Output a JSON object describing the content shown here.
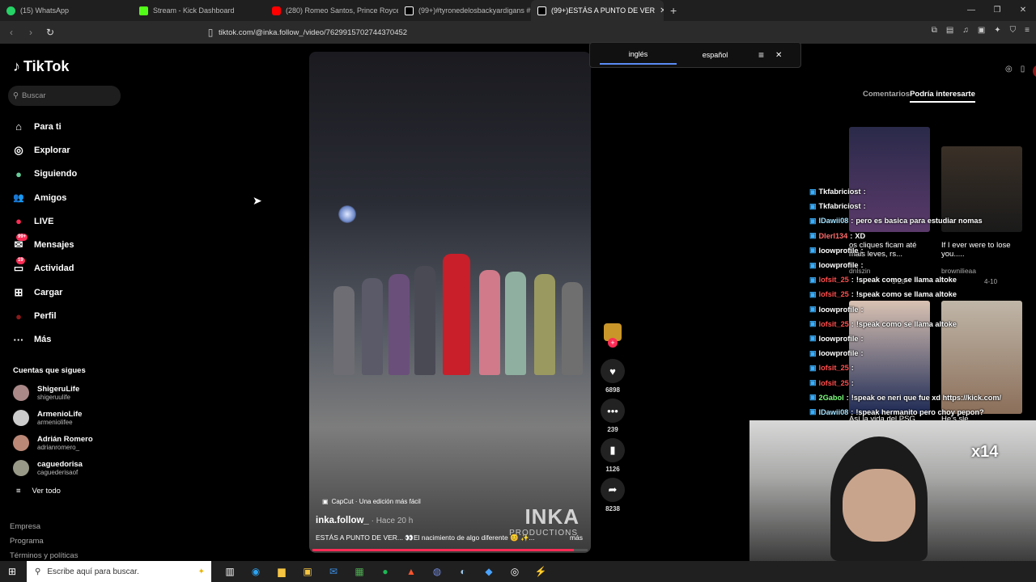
{
  "browser": {
    "tabs": [
      {
        "label": "(15) WhatsApp",
        "color": "#25d366"
      },
      {
        "label": "Stream - Kick Dashboard",
        "color": "#53fc18"
      },
      {
        "label": "(280) Romeo Santos, Prince Royce - E",
        "color": "#ff0000"
      },
      {
        "label": "(99+)#tyronedelosbackyardigans #p",
        "color": "#ffffff"
      },
      {
        "label": "(99+)ESTÁS A PUNTO DE VER",
        "color": "#ffffff"
      }
    ],
    "url": "tiktok.com/@inka.follow_/video/7629915702744370452"
  },
  "translate": {
    "opt1": "inglés",
    "opt2": "español"
  },
  "sidebar": {
    "logo": "TikTok",
    "search_placeholder": "Buscar",
    "menu": [
      {
        "label": "Para ti",
        "icon": "home-icon",
        "glyph": "⌂"
      },
      {
        "label": "Explorar",
        "icon": "compass-icon",
        "glyph": "◎"
      },
      {
        "label": "Siguiendo",
        "icon": "following-icon",
        "glyph": "●"
      },
      {
        "label": "Amigos",
        "icon": "friends-icon",
        "glyph": "👥"
      },
      {
        "label": "LIVE",
        "icon": "live-icon",
        "glyph": "●"
      },
      {
        "label": "Mensajes",
        "icon": "messages-icon",
        "glyph": "✉",
        "badge": "99+"
      },
      {
        "label": "Actividad",
        "icon": "activity-icon",
        "glyph": "▭",
        "badge": "19"
      },
      {
        "label": "Cargar",
        "icon": "upload-icon",
        "glyph": "⊞"
      },
      {
        "label": "Perfil",
        "icon": "profile-icon",
        "glyph": "●"
      },
      {
        "label": "Más",
        "icon": "more-icon",
        "glyph": "···"
      }
    ],
    "following_title": "Cuentas que sigues",
    "accounts": [
      {
        "name": "ShigeruLife",
        "handle": "shigeruulife"
      },
      {
        "name": "ArmenioLife",
        "handle": "armeniolifee"
      },
      {
        "name": "Adrián Romero",
        "handle": "adrianromero_"
      },
      {
        "name": "caguedorisa",
        "handle": "caguederisaof"
      }
    ],
    "see_all": "Ver todo",
    "footer": [
      "Empresa",
      "Programa",
      "Términos y políticas"
    ]
  },
  "video": {
    "capcut": "CapCut · Una edición más fácil",
    "watermark": "INKA",
    "watermark_sub": "PRODUCTIONS",
    "author": "inka.follow_",
    "time": " · Hace 20 h",
    "description": "ESTÁS A PUNTO DE VER... 👀El nacimiento de algo diferente 😊 ✨...",
    "more": "más",
    "progress": 0.95
  },
  "actions": {
    "likes": "6898",
    "comments": "239",
    "saves": "1126",
    "shares": "8238"
  },
  "right_panel": {
    "tab_comments": "Comentarios",
    "tab_interest": "Podría interesarte",
    "card1_title": "os cliques ficam até mais leves, rs...",
    "card1_user": "dnlszin",
    "card1_meta": "3-28",
    "card2_title": "If I ever were to lose you.....",
    "card2_user": "brownilieaa",
    "card2_meta": "4-10",
    "card3_caption": "Así la vida del PSG",
    "card4_caption": "He's sle"
  },
  "chat": [
    {
      "user": "Tkfabriciost",
      "msg": "",
      "color": "#ffffff"
    },
    {
      "user": "Tkfabriciost",
      "msg": "",
      "color": "#ffffff"
    },
    {
      "user": "IDawii08",
      "msg": "pero es basica para estudiar nomas",
      "color": "#a6e3ff"
    },
    {
      "user": "Dlerl134",
      "msg": "XD",
      "color": "#ff6b6b"
    },
    {
      "user": "loowprofile",
      "msg": "",
      "color": "#ffffff"
    },
    {
      "user": "loowprofile",
      "msg": "",
      "color": "#ffffff"
    },
    {
      "user": "lofsit_25",
      "msg": "!speak como se llama altoke",
      "color": "#ff4d4d"
    },
    {
      "user": "lofsit_25",
      "msg": "!speak como se llama altoke",
      "color": "#ff4d4d"
    },
    {
      "user": "loowprofile",
      "msg": "",
      "color": "#ffffff"
    },
    {
      "user": "lofsit_25",
      "msg": "!speak como se llama altoke",
      "color": "#ff4d4d"
    },
    {
      "user": "loowprofile",
      "msg": "",
      "color": "#ffffff"
    },
    {
      "user": "loowprofile",
      "msg": "",
      "color": "#ffffff"
    },
    {
      "user": "lofsit_25",
      "msg": "",
      "color": "#ff4d4d"
    },
    {
      "user": "lofsit_25",
      "msg": "",
      "color": "#ff4d4d"
    },
    {
      "user": "2Gabol",
      "msg": "!speak oe neri que fue xd https://kick.com/",
      "color": "#7dff7d"
    },
    {
      "user": "IDawii08",
      "msg": "!speak hermanito pero choy pepon?",
      "color": "#a6e3ff"
    }
  ],
  "overlay": {
    "x14": "x14"
  },
  "taskbar": {
    "search_placeholder": "Escribe aquí para buscar."
  }
}
